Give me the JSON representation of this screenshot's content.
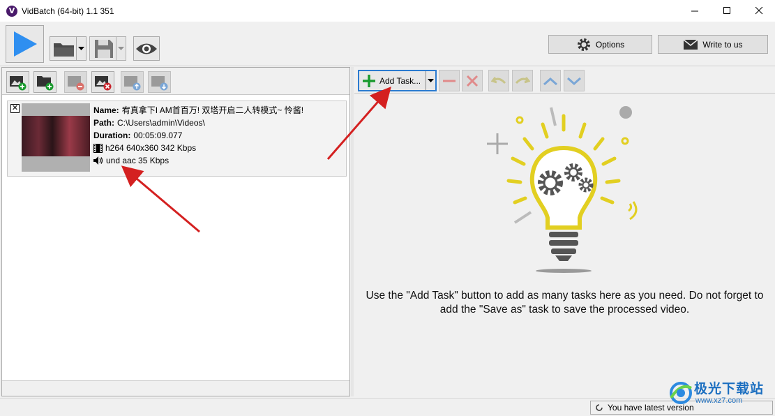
{
  "window": {
    "title": "VidBatch (64-bit) 1.1 351"
  },
  "toolbar": {
    "options_label": "Options",
    "write_label": "Write to us"
  },
  "file": {
    "name_label": "Name:",
    "name_value": "宥真拿下I AM首百万! 双塔开启二人转模式~ 怜酱!",
    "path_label": "Path:",
    "path_value": "C:\\Users\\admin\\Videos\\",
    "duration_label": "Duration:",
    "duration_value": "00:05:09.077",
    "video_stream": "h264 640x360 342 Kbps",
    "audio_stream": "und aac 35 Kbps",
    "checked_mark": "✕"
  },
  "tasks": {
    "add_task_label": "Add Task...",
    "help_text": "Use the \"Add Task\" button to add as many tasks here as you need. Do not forget to add the \"Save as\" task to save the processed video."
  },
  "status": {
    "version_text": "You have latest version"
  },
  "watermark": {
    "title": "极光下载站",
    "url": "www.xz7.com"
  },
  "colors": {
    "accent": "#2b7bd0",
    "play_blue": "#2f8ff0",
    "bulb_yellow": "#e2cf21",
    "arrow_red": "#d42020"
  }
}
